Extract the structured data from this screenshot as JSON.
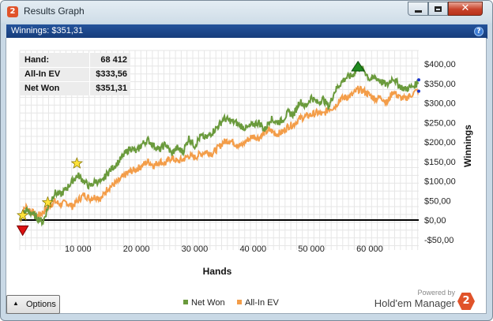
{
  "window": {
    "title": "Results Graph",
    "app_icon_text": "2"
  },
  "infobar": {
    "label": "Winnings: $351,31"
  },
  "stats": [
    {
      "key": "Hand:",
      "value": "68 412"
    },
    {
      "key": "All-In EV",
      "value": "$333,56"
    },
    {
      "key": "Net Won",
      "value": "$351,31"
    }
  ],
  "chart_data": {
    "type": "line",
    "xlabel": "Hands",
    "ylabel": "Winnings",
    "xlim": [
      0,
      68412
    ],
    "ylim": [
      -50,
      400
    ],
    "x_ticks": [
      "10 000",
      "20 000",
      "30 000",
      "40 000",
      "50 000",
      "60 000"
    ],
    "y_ticks": [
      "-$50,00",
      "$0,00",
      "$50,00",
      "$100,00",
      "$150,00",
      "$200,00",
      "$250,00",
      "$300,00",
      "$350,00",
      "$400,00"
    ],
    "grid": true,
    "legend_position": "bottom",
    "series": [
      {
        "name": "Net Won",
        "color": "#6a9a3c",
        "points": [
          [
            0,
            0
          ],
          [
            1000,
            25
          ],
          [
            2000,
            18
          ],
          [
            3000,
            5
          ],
          [
            4000,
            -5
          ],
          [
            5000,
            40
          ],
          [
            6000,
            70
          ],
          [
            7000,
            65
          ],
          [
            8000,
            80
          ],
          [
            9000,
            100
          ],
          [
            10000,
            115
          ],
          [
            11000,
            100
          ],
          [
            12000,
            85
          ],
          [
            13000,
            100
          ],
          [
            14000,
            95
          ],
          [
            15000,
            120
          ],
          [
            16000,
            135
          ],
          [
            17000,
            150
          ],
          [
            18000,
            170
          ],
          [
            19000,
            185
          ],
          [
            20000,
            175
          ],
          [
            21000,
            195
          ],
          [
            22000,
            205
          ],
          [
            23000,
            190
          ],
          [
            24000,
            180
          ],
          [
            25000,
            195
          ],
          [
            26000,
            170
          ],
          [
            27000,
            185
          ],
          [
            28000,
            175
          ],
          [
            29000,
            210
          ],
          [
            30000,
            190
          ],
          [
            31000,
            215
          ],
          [
            32000,
            210
          ],
          [
            33000,
            225
          ],
          [
            34000,
            240
          ],
          [
            35000,
            260
          ],
          [
            36000,
            255
          ],
          [
            37000,
            250
          ],
          [
            38000,
            240
          ],
          [
            39000,
            235
          ],
          [
            40000,
            245
          ],
          [
            41000,
            250
          ],
          [
            42000,
            230
          ],
          [
            43000,
            260
          ],
          [
            44000,
            250
          ],
          [
            45000,
            255
          ],
          [
            46000,
            275
          ],
          [
            47000,
            270
          ],
          [
            48000,
            305
          ],
          [
            49000,
            290
          ],
          [
            50000,
            315
          ],
          [
            51000,
            300
          ],
          [
            52000,
            310
          ],
          [
            53000,
            290
          ],
          [
            54000,
            330
          ],
          [
            55000,
            350
          ],
          [
            56000,
            365
          ],
          [
            57000,
            370
          ],
          [
            58000,
            390
          ],
          [
            59000,
            385
          ],
          [
            60000,
            360
          ],
          [
            61000,
            365
          ],
          [
            62000,
            355
          ],
          [
            63000,
            345
          ],
          [
            64000,
            365
          ],
          [
            65000,
            345
          ],
          [
            66000,
            335
          ],
          [
            67000,
            340
          ],
          [
            68412,
            351
          ]
        ]
      },
      {
        "name": "All-In EV",
        "color": "#f39d49",
        "points": [
          [
            0,
            0
          ],
          [
            1000,
            35
          ],
          [
            2000,
            22
          ],
          [
            3000,
            10
          ],
          [
            4000,
            20
          ],
          [
            5000,
            35
          ],
          [
            6000,
            48
          ],
          [
            7000,
            40
          ],
          [
            8000,
            45
          ],
          [
            9000,
            35
          ],
          [
            10000,
            50
          ],
          [
            11000,
            65
          ],
          [
            12000,
            55
          ],
          [
            13000,
            60
          ],
          [
            14000,
            55
          ],
          [
            15000,
            80
          ],
          [
            16000,
            90
          ],
          [
            17000,
            100
          ],
          [
            18000,
            115
          ],
          [
            19000,
            125
          ],
          [
            20000,
            130
          ],
          [
            21000,
            140
          ],
          [
            22000,
            150
          ],
          [
            23000,
            140
          ],
          [
            24000,
            150
          ],
          [
            25000,
            145
          ],
          [
            26000,
            160
          ],
          [
            27000,
            150
          ],
          [
            28000,
            155
          ],
          [
            29000,
            165
          ],
          [
            30000,
            160
          ],
          [
            31000,
            170
          ],
          [
            32000,
            175
          ],
          [
            33000,
            170
          ],
          [
            34000,
            185
          ],
          [
            35000,
            200
          ],
          [
            36000,
            205
          ],
          [
            37000,
            195
          ],
          [
            38000,
            190
          ],
          [
            39000,
            205
          ],
          [
            40000,
            215
          ],
          [
            41000,
            210
          ],
          [
            42000,
            225
          ],
          [
            43000,
            230
          ],
          [
            44000,
            220
          ],
          [
            45000,
            225
          ],
          [
            46000,
            240
          ],
          [
            47000,
            245
          ],
          [
            48000,
            260
          ],
          [
            49000,
            265
          ],
          [
            50000,
            270
          ],
          [
            51000,
            275
          ],
          [
            52000,
            270
          ],
          [
            53000,
            285
          ],
          [
            54000,
            290
          ],
          [
            55000,
            310
          ],
          [
            56000,
            315
          ],
          [
            57000,
            320
          ],
          [
            58000,
            335
          ],
          [
            59000,
            330
          ],
          [
            60000,
            320
          ],
          [
            61000,
            310
          ],
          [
            62000,
            315
          ],
          [
            63000,
            300
          ],
          [
            64000,
            330
          ],
          [
            65000,
            315
          ],
          [
            66000,
            310
          ],
          [
            67000,
            320
          ],
          [
            68412,
            334
          ]
        ]
      }
    ]
  },
  "legend": [
    {
      "label": "Net Won",
      "color": "#6a9a3c"
    },
    {
      "label": "All-In EV",
      "color": "#f39d49"
    }
  ],
  "options_button": {
    "label": "Options"
  },
  "brand": {
    "powered": "Powered by",
    "name": "Hold'em Manager",
    "logo_text": "2"
  },
  "colors": {
    "infobar": "#1f4a8f",
    "zero_line": "#000000",
    "max_marker": "#1f8a1f",
    "min_marker": "#dd1111",
    "star": "#ffe23a"
  }
}
